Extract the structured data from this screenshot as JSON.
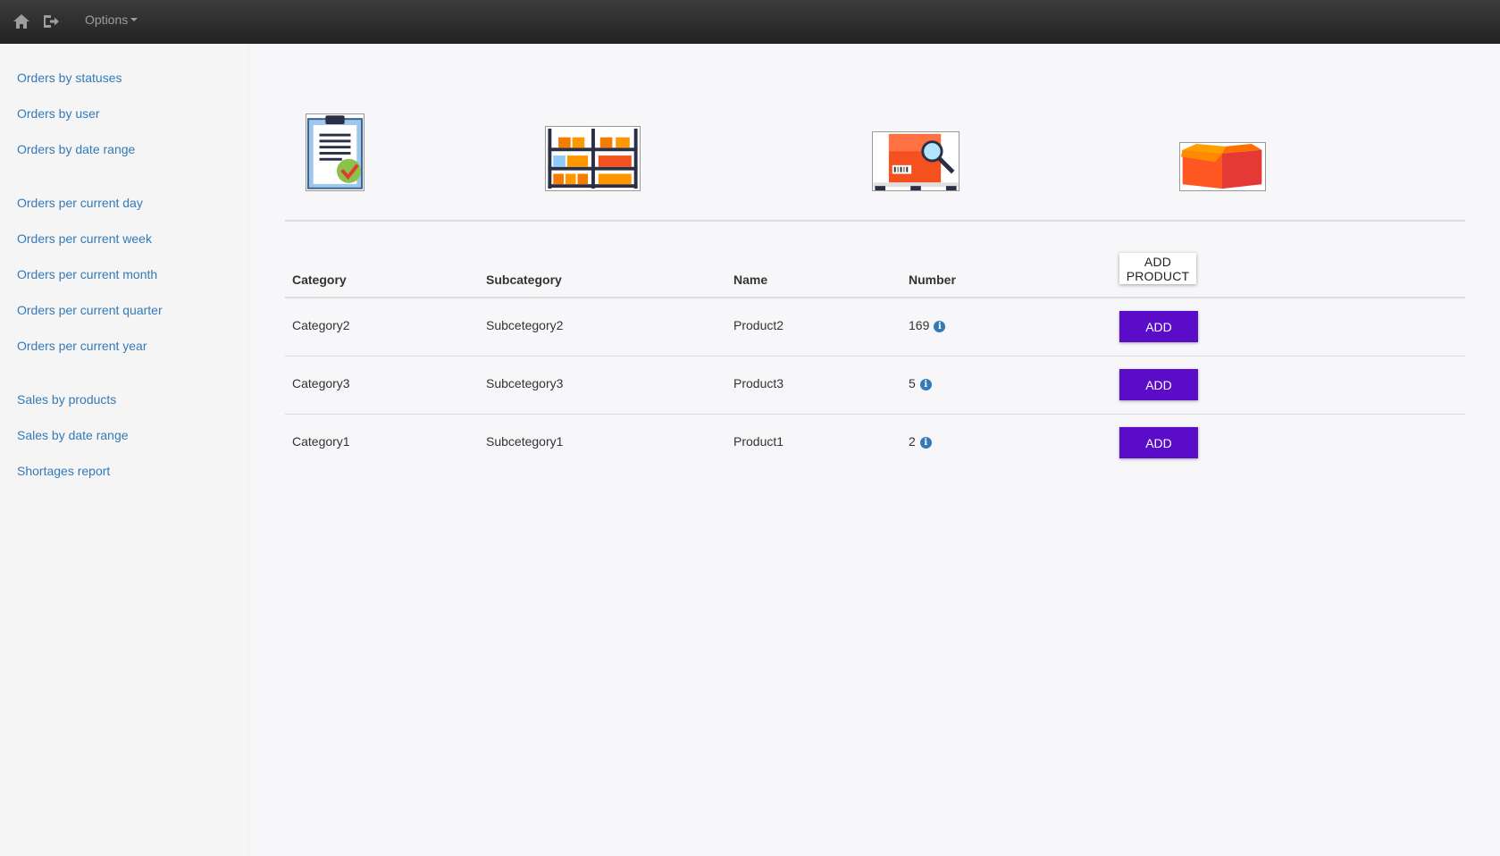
{
  "topbar": {
    "home_icon": "home-icon",
    "logout_icon": "logout-icon",
    "options_label": "Options"
  },
  "sidebar": {
    "groups": [
      [
        "Orders by statuses",
        "Orders by user",
        "Orders by date range"
      ],
      [
        "Orders per current day",
        "Orders per current week",
        "Orders per current month",
        "Orders per current quarter",
        "Orders per current year"
      ],
      [
        "Sales by products",
        "Sales by date range",
        "Shortages report"
      ]
    ]
  },
  "illustrations": [
    "clipboard-checklist-icon",
    "warehouse-shelves-icon",
    "package-inspection-icon",
    "open-box-icon"
  ],
  "table": {
    "headers": {
      "category": "Category",
      "subcategory": "Subcategory",
      "name": "Name",
      "number": "Number"
    },
    "add_product_label": "ADD PRODUCT",
    "rows": [
      {
        "category": "Category2",
        "subcategory": "Subcetegory2",
        "name": "Product2",
        "number": "169",
        "action": "ADD"
      },
      {
        "category": "Category3",
        "subcategory": "Subcetegory3",
        "name": "Product3",
        "number": "5",
        "action": "ADD"
      },
      {
        "category": "Category1",
        "subcategory": "Subcetegory1",
        "name": "Product1",
        "number": "2",
        "action": "ADD"
      }
    ]
  },
  "colors": {
    "accent": "#5a0cc8",
    "link": "#337ab7",
    "topbar": "#2b2b2b"
  }
}
